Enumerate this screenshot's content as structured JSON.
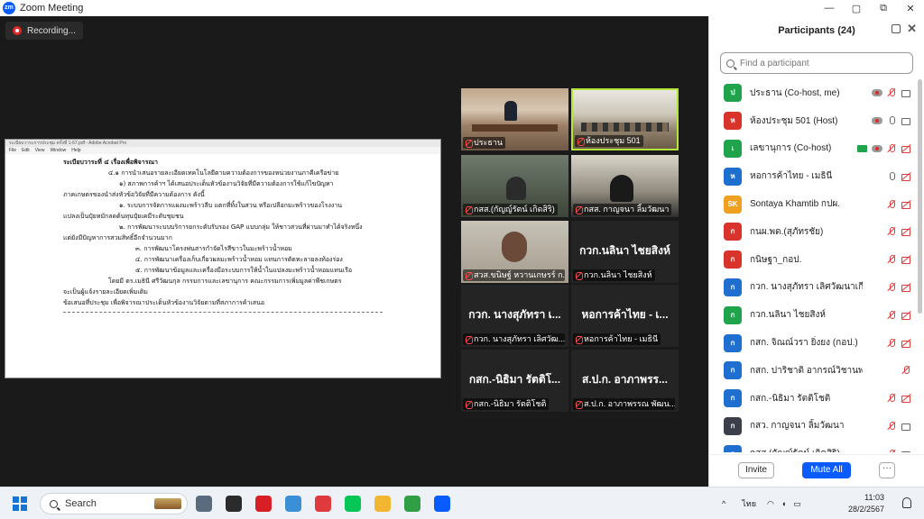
{
  "window": {
    "title": "Zoom Meeting",
    "controls": [
      "—",
      "▢",
      "⧉",
      "✕"
    ]
  },
  "recording": {
    "label": "Recording..."
  },
  "shared_doc": {
    "window_title": "ระเบียบวาระการประชุม ครั้งที่ 1-67.pdf - Adobe Acrobat Pro",
    "menu": [
      "File",
      "Edit",
      "View",
      "Window",
      "Help"
    ],
    "lines": [
      {
        "text": "ระเบียบวาระที่ ๔ เรื่องเพื่อพิจารณา",
        "cls": "hd"
      },
      {
        "text": "๔.๑ การนำเสนอรายละเอียดเทคโนโลยีตามความต้องการของหน่วยงานภาคีเครือข่าย",
        "cls": "i1"
      },
      {
        "text": "๑) สภาพการค้าฯ ได้เสนอประเด็นหัวข้องานวิจัยที่มีความต้องการใช้แก้ไขปัญหา",
        "cls": "i2"
      },
      {
        "text": "ภาคเกษตรของนำส่งหัวข้อวิจัยที่มีความต้องการ ดังนี้",
        "cls": "i0"
      },
      {
        "text": "๑. ระบบการจัดการแผงมะพร้าวลีบ แตกที่ทิ้งในสวน หรือเปลือกมะพร้าวของโรงงาน",
        "cls": "i2"
      },
      {
        "text": "แปลงเป็นปุ๋ยหมักลดต้นทุนปุ๋ยเคมีระดับชุมชน",
        "cls": "i0"
      },
      {
        "text": "๒. การพัฒนาระบบบริการยกระดับรับรอง GAP แบบกลุ่ม ให้ชาวสวนที่ผ่านมาทำได้จริงหนึ่ง",
        "cls": "i2"
      },
      {
        "text": "แต่ยังมีปัญหาการสวมสิทธิ์อีกจำนวนมาก",
        "cls": "i0"
      },
      {
        "text": "๓. การพัฒนาโครงพ่นสารกำจัดไรสีขาวในมะพร้าวน้ำหอม",
        "cls": "i3"
      },
      {
        "text": "๔. การพัฒนาเครื่องเก็บเกี่ยวผลมะพร้าวน้ำหอม แทนการตัดทะลายลงท้องร่อง",
        "cls": "i3"
      },
      {
        "text": "๕. การพัฒนาข้อมูลและเครื่องมือระบบการให้น้ำในแปลงมะพร้าวน้ำหอมแทนเรือ",
        "cls": "i3"
      },
      {
        "text": "โดยมี ดร.เมธินี ศรีวัฒนกุล กรรมการและเลขานุการ คณะกรรมการเพิ่มมูลค่าพืชเกษตร",
        "cls": "i1"
      },
      {
        "text": "จะเป็นผู้แจ้งรายละเอียดเพิ่มเติม",
        "cls": "i0"
      },
      {
        "text": "ข้อเสนอที่ประชุม เพื่อพิจารณาประเด็นหัวข้องานวิจัยตามที่สภาการค้าเสนอ",
        "cls": "i0"
      }
    ]
  },
  "gallery": [
    {
      "label": "ประธาน",
      "scene": "room",
      "big": ""
    },
    {
      "label": "ห้องประชุม 501",
      "scene": "hall",
      "big": "",
      "active": true
    },
    {
      "label": "กสส.(กัญญ์รัตน์ เกิดสิริ)",
      "scene": "person",
      "big": ""
    },
    {
      "label": "กสส. กาญจนา ลิ้มวัฒนา",
      "scene": "blur",
      "big": ""
    },
    {
      "label": "สวส.ขนิษฐ์ หวานเกษรร์ ก...",
      "scene": "face",
      "big": ""
    },
    {
      "label": "กวก.นลินา ไชยสิงห์",
      "scene": "",
      "big": "กวก.นลินา ไชยสิงห์"
    },
    {
      "label": "กวก. นางสุภัทรา เลิศวัฒ...",
      "scene": "",
      "big": "กวก. นางสุภัทรา เ..."
    },
    {
      "label": "หอการค้าไทย - เมธินี",
      "scene": "",
      "big": "หอการค้าไทย - เ..."
    },
    {
      "label": "กสก.-นิธิมา รัตติโชติ",
      "scene": "",
      "big": "กสก.-นิธิมา รัตติโ..."
    },
    {
      "label": "ส.ป.ก. อาภาพรรณ พัฒน...",
      "scene": "",
      "big": "ส.ป.ก. อาภาพรร..."
    }
  ],
  "participants_panel": {
    "title": "Participants (24)",
    "search_placeholder": "Find a participant",
    "invite_label": "Invite",
    "mute_all_label": "Mute All",
    "more_label": "···",
    "items": [
      {
        "initial": "ป",
        "color": "#1fa44b",
        "name": "ประธาน (Co-host, me)",
        "icons": [
          "rec",
          "mic-off",
          "cam-on"
        ]
      },
      {
        "initial": "ห",
        "color": "#d9342b",
        "name": "ห้องประชุม 501 (Host)",
        "icons": [
          "rec",
          "mic-on",
          "cam-on"
        ]
      },
      {
        "initial": "เ",
        "color": "#1fa44b",
        "name": "เลขานุการ (Co-host)",
        "icons": [
          "share",
          "rec",
          "mic-off",
          "cam-off"
        ]
      },
      {
        "initial": "ห",
        "color": "#1e6fcf",
        "name": "หอการค้าไทย - เมธินี",
        "icons": [
          "mic-on",
          "cam-off"
        ]
      },
      {
        "initial": "SK",
        "color": "#f0a020",
        "name": "Sontaya Khamtib กปผ.",
        "icons": [
          "mic-off",
          "cam-off"
        ]
      },
      {
        "initial": "ก",
        "color": "#d9342b",
        "name": "กนผ.พด.(สุภัทรชัย)",
        "icons": [
          "mic-off",
          "cam-off"
        ]
      },
      {
        "initial": "ก",
        "color": "#d9342b",
        "name": "กนิษฐา_กอป.",
        "icons": [
          "mic-off",
          "cam-off"
        ]
      },
      {
        "initial": "ก",
        "color": "#1e6fcf",
        "name": "กวก. นางสุภัทรา เลิศวัฒนาเกียรติ",
        "icons": [
          "mic-off",
          "cam-off"
        ]
      },
      {
        "initial": "ก",
        "color": "#1fa44b",
        "name": "กวก.นลินา ไชยสิงห์",
        "icons": [
          "mic-off",
          "cam-off"
        ]
      },
      {
        "initial": "ก",
        "color": "#1e6fcf",
        "name": "กสก. จิณณ์วรา ยิ่งยง (กอป.)",
        "icons": [
          "mic-off",
          "cam-off"
        ]
      },
      {
        "initial": "ก",
        "color": "#1e6fcf",
        "name": "กสก. ปาริชาติ อากรณ์วิชานพ",
        "icons": [
          "mic-off"
        ]
      },
      {
        "initial": "ก",
        "color": "#1e6fcf",
        "name": "กสก.-นิธิมา รัตติโชติ",
        "icons": [
          "mic-off",
          "cam-off"
        ]
      },
      {
        "initial": "ก",
        "color": "#3b3f4a",
        "name": "กสว. กาญจนา ลิ้มวัฒนา",
        "icons": [
          "mic-off",
          "cam-on"
        ]
      },
      {
        "initial": "ก",
        "color": "#1e6fcf",
        "name": "กสส.(กัญญ์รัตน์ เกิดสิริ)",
        "icons": [
          "mic-off",
          "cam-on"
        ]
      }
    ]
  },
  "taskbar": {
    "search_label": "Search",
    "apps": [
      {
        "name": "task-view-icon",
        "color": "#5a6b7d"
      },
      {
        "name": "speedometer-icon",
        "color": "#2b2b2b"
      },
      {
        "name": "netflix-icon",
        "color": "#d81f26"
      },
      {
        "name": "weather-icon",
        "color": "#3a8fd6"
      },
      {
        "name": "anydesk-icon",
        "color": "#e0393e"
      },
      {
        "name": "line-icon",
        "color": "#06c755"
      },
      {
        "name": "folder-icon",
        "color": "#f2b630"
      },
      {
        "name": "chrome-icon",
        "color": "#2f9e44"
      },
      {
        "name": "zoom-icon",
        "color": "#0b5cff"
      }
    ],
    "tray_chevron": "^",
    "language": "ไทย",
    "time": "11:03",
    "date": "28/2/2567"
  }
}
